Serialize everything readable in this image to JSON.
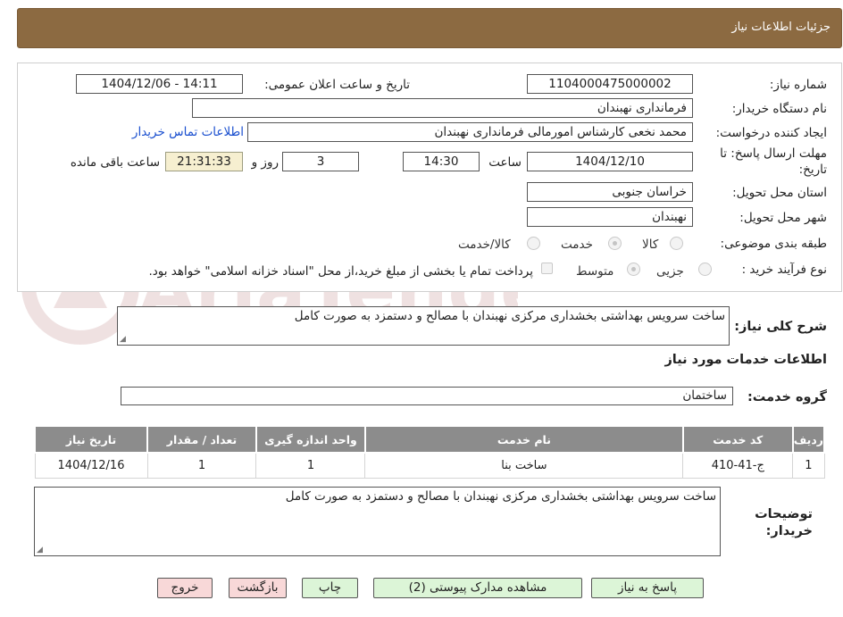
{
  "header": {
    "title": "جزئیات اطلاعات نیاز"
  },
  "form": {
    "need_number_label": "شماره نیاز:",
    "need_number": "1104000475000002",
    "announce_label": "تاریخ و ساعت اعلان عمومی:",
    "announce_value": "1404/12/06 - 14:11",
    "buyer_org_label": "نام دستگاه خریدار:",
    "buyer_org": "فرمانداری نهبندان",
    "creator_label": "ایجاد کننده درخواست:",
    "creator": "محمد نخعی کارشناس امورمالی  فرمانداری نهبندان",
    "contact_link": "اطلاعات تماس خریدار",
    "deadline_label_1": "مهلت ارسال پاسخ: تا",
    "deadline_label_2": "تاریخ:",
    "deadline_date": "1404/12/10",
    "hour_label": "ساعت",
    "deadline_time": "14:30",
    "days_value": "3",
    "days_label": "روز و",
    "time_left": "21:31:33",
    "time_left_label": "ساعت باقی مانده",
    "province_label": "استان محل تحویل:",
    "province": "خراسان جنوبی",
    "city_label": "شهر محل تحویل:",
    "city": "نهبندان",
    "category_label": "طبقه بندی موضوعی:",
    "category_options": [
      "کالا",
      "خدمت",
      "کالا/خدمت"
    ],
    "category_selected": "خدمت",
    "process_label": "نوع فرآیند خرید :",
    "process_options": [
      "جزیی",
      "متوسط"
    ],
    "process_selected": "متوسط",
    "payment_note": "پرداخت تمام یا بخشی از مبلغ خرید،از محل \"اسناد خزانه اسلامی\" خواهد بود."
  },
  "summary": {
    "label": "شرح کلی نیاز:",
    "text": "ساخت سرویس بهداشتی بخشداری مرکزی نهبندان با مصالح و دستمزد به صورت کامل"
  },
  "services": {
    "section_title": "اطلاعات خدمات مورد نیاز",
    "group_label": "گروه خدمت:",
    "group_value": "ساختمان",
    "columns": [
      "ردیف",
      "کد خدمت",
      "نام خدمت",
      "واحد اندازه گیری",
      "تعداد / مقدار",
      "تاریخ نیاز"
    ],
    "rows": [
      [
        "1",
        "ج-41-410",
        "ساخت بنا",
        "1",
        "1",
        "1404/12/16"
      ]
    ]
  },
  "buyer_notes": {
    "label_1": "توضیحات",
    "label_2": "خریدار:",
    "text": "ساخت سرویس بهداشتی بخشداری مرکزی نهبندان با مصالح و دستمزد به صورت کامل"
  },
  "buttons": {
    "reply": "پاسخ به نیاز",
    "view_docs": "مشاهده مدارک پیوستی (2)",
    "print": "چاپ",
    "back": "بازگشت",
    "exit": "خروج"
  },
  "watermark": {
    "text": "AriaTender.neT"
  },
  "colors": {
    "header": "#8c6a41",
    "table_header": "#8c8c8c",
    "button_green": "#dcf5d7",
    "button_pink": "#f8d8d8",
    "link": "#1a4fcf"
  }
}
